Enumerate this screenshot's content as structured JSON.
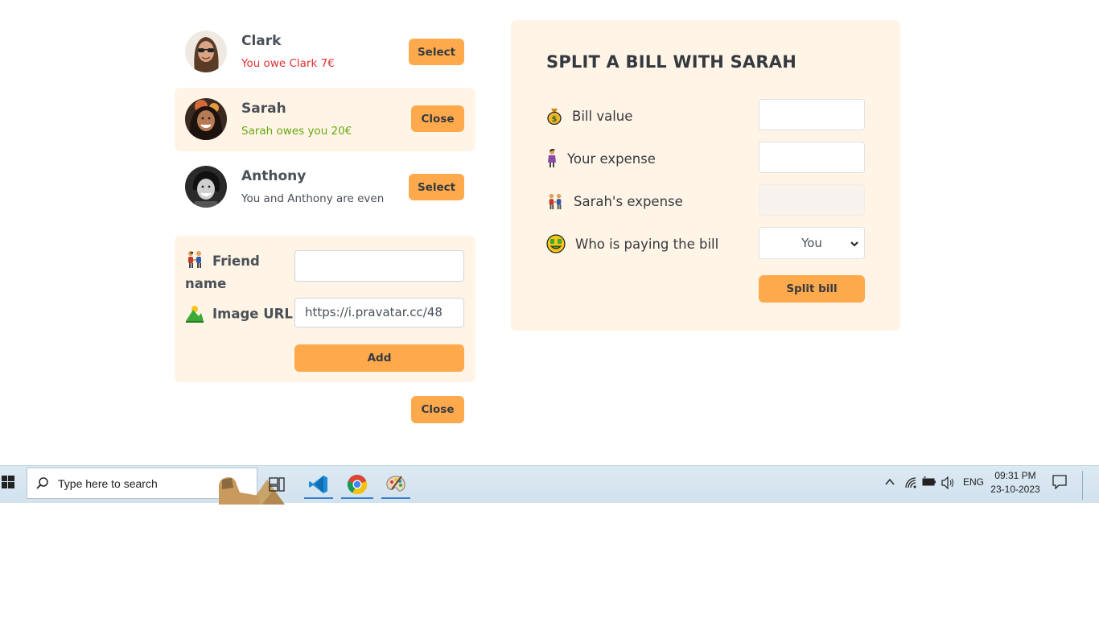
{
  "friends": [
    {
      "name": "Clark",
      "status": "You owe Clark 7€",
      "button": "Select",
      "selected": false
    },
    {
      "name": "Sarah",
      "status": "Sarah owes you 20€",
      "button": "Close",
      "selected": true
    },
    {
      "name": "Anthony",
      "status": "You and Anthony are even",
      "button": "Select",
      "selected": false
    }
  ],
  "add_friend_form": {
    "name_label": "Friend name",
    "name_label_line1": "Friend",
    "name_label_line2": "name",
    "name_value": "",
    "image_label": "Image URL",
    "image_value": "https://i.pravatar.cc/48",
    "add_button": "Add"
  },
  "close_button": "Close",
  "split_form": {
    "title": "SPLIT A BILL WITH SARAH",
    "bill_label": "Bill value",
    "your_expense_label": "Your expense",
    "friend_expense_label": "Sarah's expense",
    "payer_label": "Who is paying the bill",
    "payer_selected": "You",
    "submit_button": "Split bill"
  },
  "taskbar": {
    "search_placeholder": "Type here to search",
    "language": "ENG",
    "time": "09:31 PM",
    "date": "23-10-2023"
  },
  "colors": {
    "accent": "#ffa94d",
    "panel_bg": "#fff4e6",
    "owe_red": "#e03131",
    "owed_green": "#66a80f"
  }
}
